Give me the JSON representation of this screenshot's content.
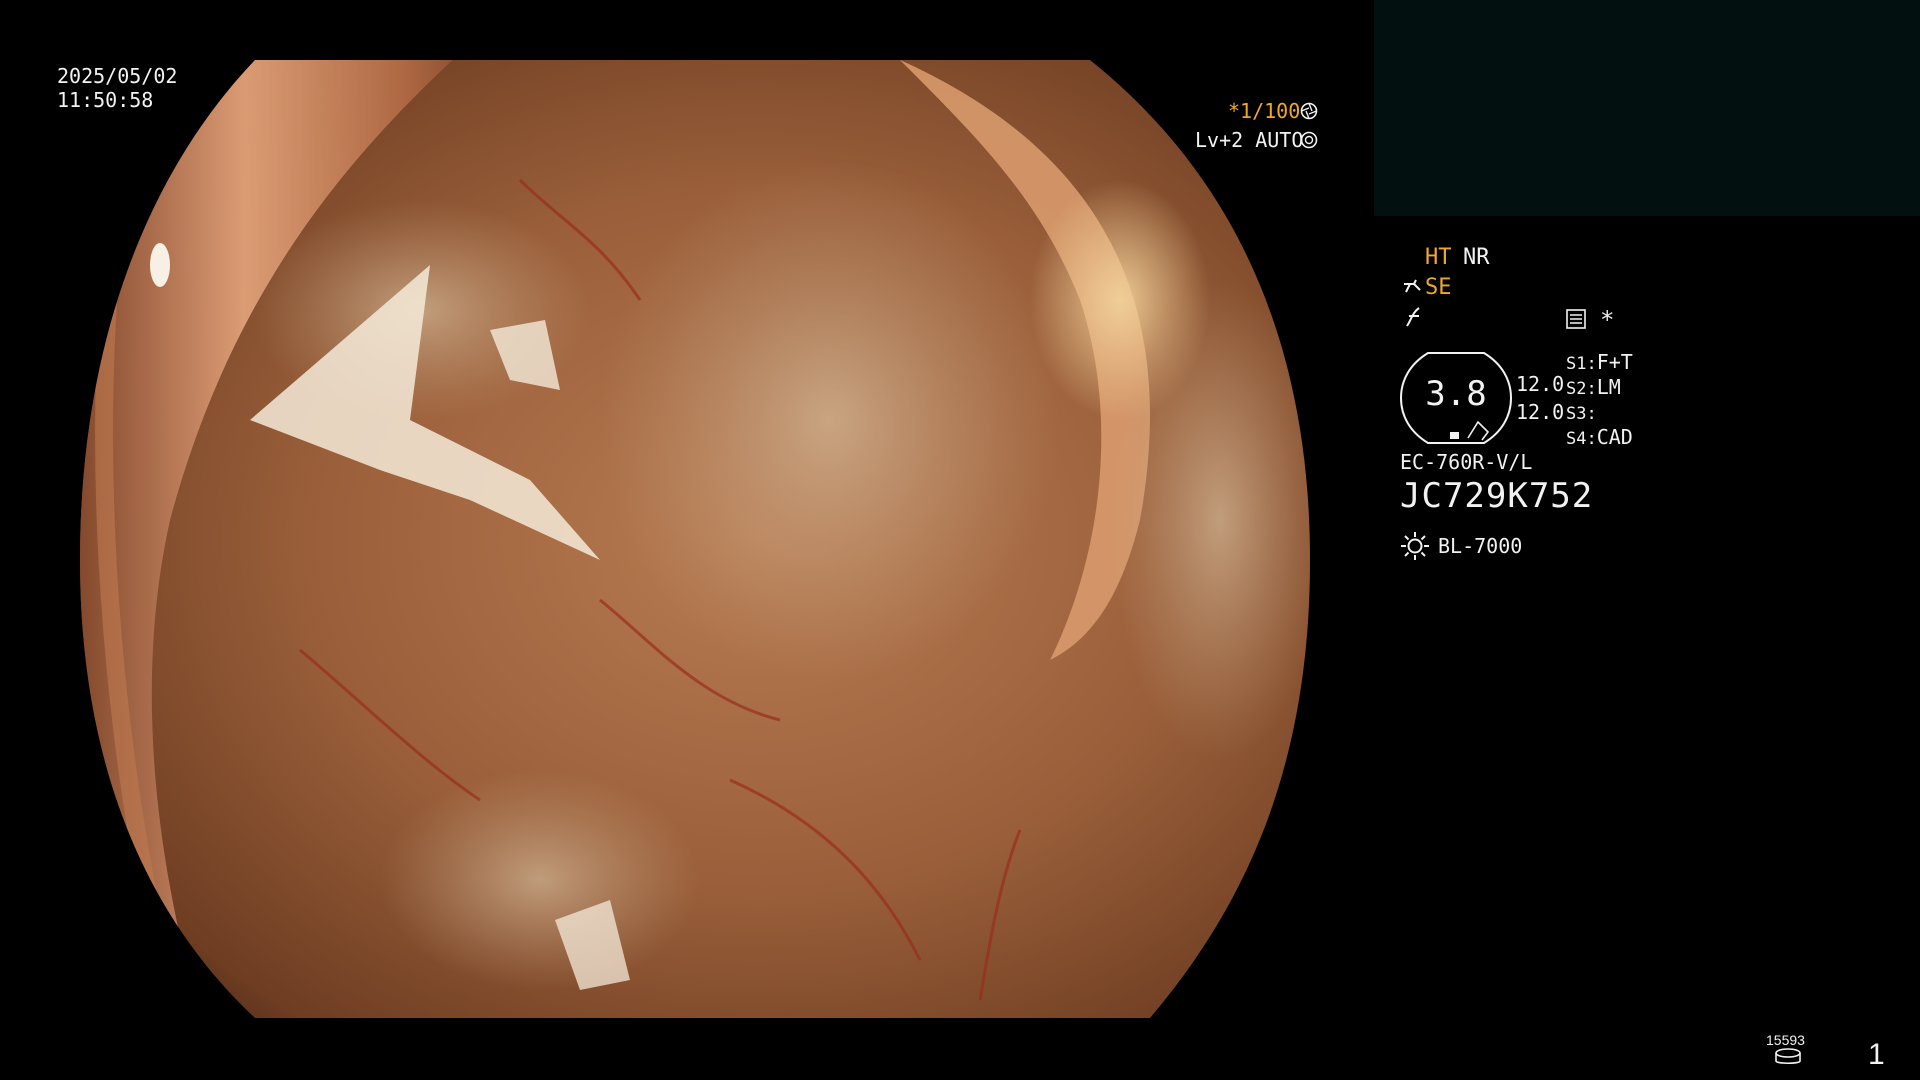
{
  "header": {
    "date": "2025/05/02",
    "time": "11:50:58"
  },
  "exposure": {
    "shutter": "*1/100",
    "level": "Lv+2 AUTO"
  },
  "processing": {
    "ht": "HT",
    "nr": "NR",
    "se": "SE",
    "asterisk": "*"
  },
  "gauge": {
    "value": "3.8",
    "val1": "12.0",
    "val2": "12.0"
  },
  "switches": [
    {
      "key": "S1:",
      "value": "F+T"
    },
    {
      "key": "S2:",
      "value": "LM"
    },
    {
      "key": "S3:",
      "value": ""
    },
    {
      "key": "S4:",
      "value": "CAD"
    }
  ],
  "scope": {
    "model": "EC-760R-V/L",
    "serial": "JC729K752"
  },
  "light": {
    "source": "BL-7000"
  },
  "footer": {
    "counter": "15593",
    "page": "1"
  },
  "colors": {
    "accent": "#f0a828",
    "text": "#f2f2f2",
    "panel": "#021010"
  },
  "icons": [
    "shutter-icon",
    "iris-icon",
    "scope-hand-icon",
    "enhance-icon",
    "menu-list-icon",
    "light-source-icon",
    "storage-disc-icon"
  ]
}
